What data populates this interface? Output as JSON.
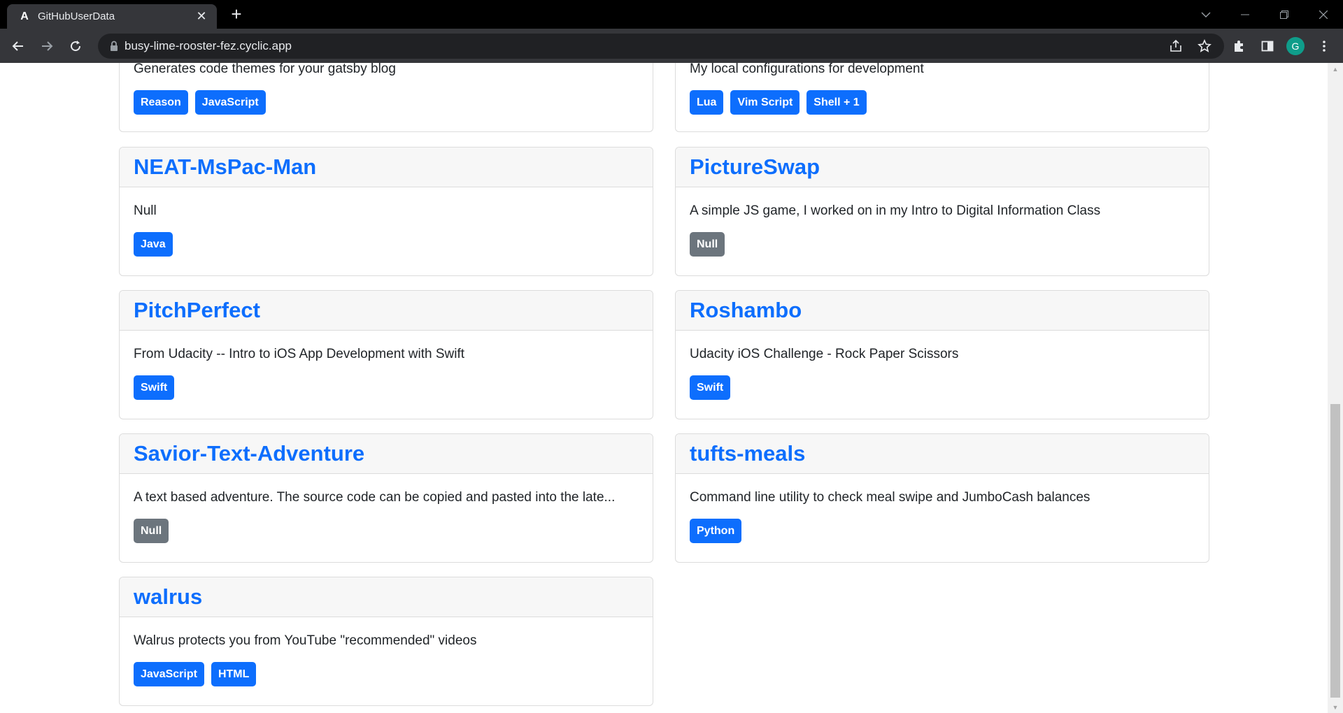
{
  "browser": {
    "tab_title": "GitHubUserData",
    "tab_favicon": "A",
    "url": "busy-lime-rooster-fez.cyclic.app",
    "profile_initial": "G"
  },
  "icons": {
    "back": "arrow-left-icon",
    "forward": "arrow-right-icon",
    "reload": "reload-icon",
    "lock": "lock-icon",
    "share": "share-icon",
    "bookmark": "star-icon",
    "extensions": "puzzle-icon",
    "sidepanel": "side-panel-icon",
    "menu": "kebab-menu-icon"
  },
  "colors": {
    "link": "#0d6efd",
    "badge_primary": "#0d6efd",
    "badge_secondary": "#6c757d"
  },
  "repos": [
    {
      "name": "",
      "description": "Generates code themes for your gatsby blog",
      "languages": [
        {
          "label": "Reason",
          "style": "primary"
        },
        {
          "label": "JavaScript",
          "style": "primary"
        }
      ]
    },
    {
      "name": "",
      "description": "My local configurations for development",
      "languages": [
        {
          "label": "Lua",
          "style": "primary"
        },
        {
          "label": "Vim Script",
          "style": "primary"
        },
        {
          "label": "Shell + 1",
          "style": "primary"
        }
      ]
    },
    {
      "name": "NEAT-MsPac-Man",
      "description": "Null",
      "languages": [
        {
          "label": "Java",
          "style": "primary"
        }
      ]
    },
    {
      "name": "PictureSwap",
      "description": "A simple JS game, I worked on in my Intro to Digital Information Class",
      "languages": [
        {
          "label": "Null",
          "style": "secondary"
        }
      ]
    },
    {
      "name": "PitchPerfect",
      "description": "From Udacity -- Intro to iOS App Development with Swift",
      "languages": [
        {
          "label": "Swift",
          "style": "primary"
        }
      ]
    },
    {
      "name": "Roshambo",
      "description": "Udacity iOS Challenge - Rock Paper Scissors",
      "languages": [
        {
          "label": "Swift",
          "style": "primary"
        }
      ]
    },
    {
      "name": "Savior-Text-Adventure",
      "description": "A text based adventure. The source code can be copied and pasted into the late...",
      "languages": [
        {
          "label": "Null",
          "style": "secondary"
        }
      ]
    },
    {
      "name": "tufts-meals",
      "description": "Command line utility to check meal swipe and JumboCash balances",
      "languages": [
        {
          "label": "Python",
          "style": "primary"
        }
      ]
    },
    {
      "name": "walrus",
      "description": "Walrus protects you from YouTube \"recommended\" videos",
      "languages": [
        {
          "label": "JavaScript",
          "style": "primary"
        },
        {
          "label": "HTML",
          "style": "primary"
        }
      ]
    }
  ]
}
